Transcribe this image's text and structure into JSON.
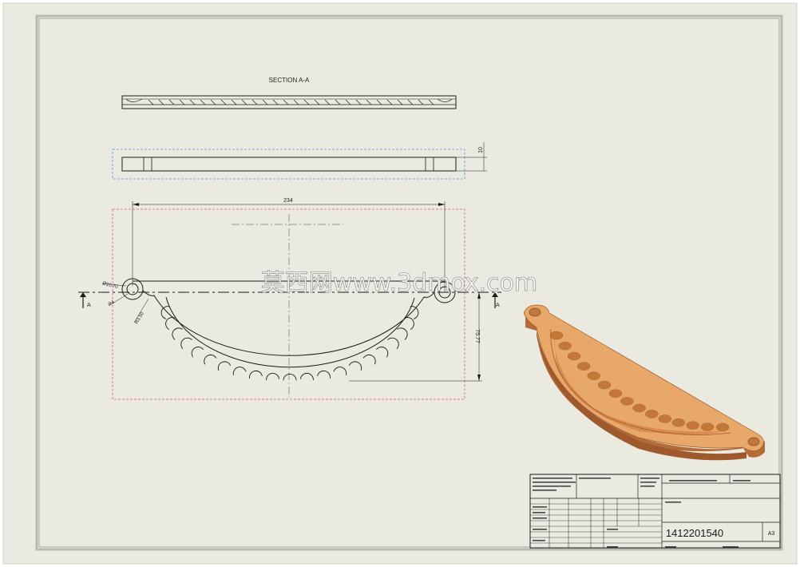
{
  "drawing": {
    "section_label": "SECTION A-A",
    "watermark": "莫西网www.3dmox.com",
    "dimensions": {
      "overall_width": "234",
      "thickness": "10",
      "height": "75.77",
      "hole_diameter": "Ø10.70",
      "hole_radius": "R4",
      "fillet_radius": "R3.50"
    },
    "section_marks": {
      "left": "A",
      "right": "A"
    }
  },
  "title_block": {
    "drawing_number": "1412201540",
    "sheet_size": "A3"
  },
  "colors": {
    "sheet_background": "#ebeae1",
    "line": "#1a1a1a",
    "construction_line": "#d9578a",
    "selection_line": "#5b8fd8",
    "part_face": "#e8a86a",
    "part_side": "#b36b38",
    "part_scoop": "#d98b4e"
  }
}
